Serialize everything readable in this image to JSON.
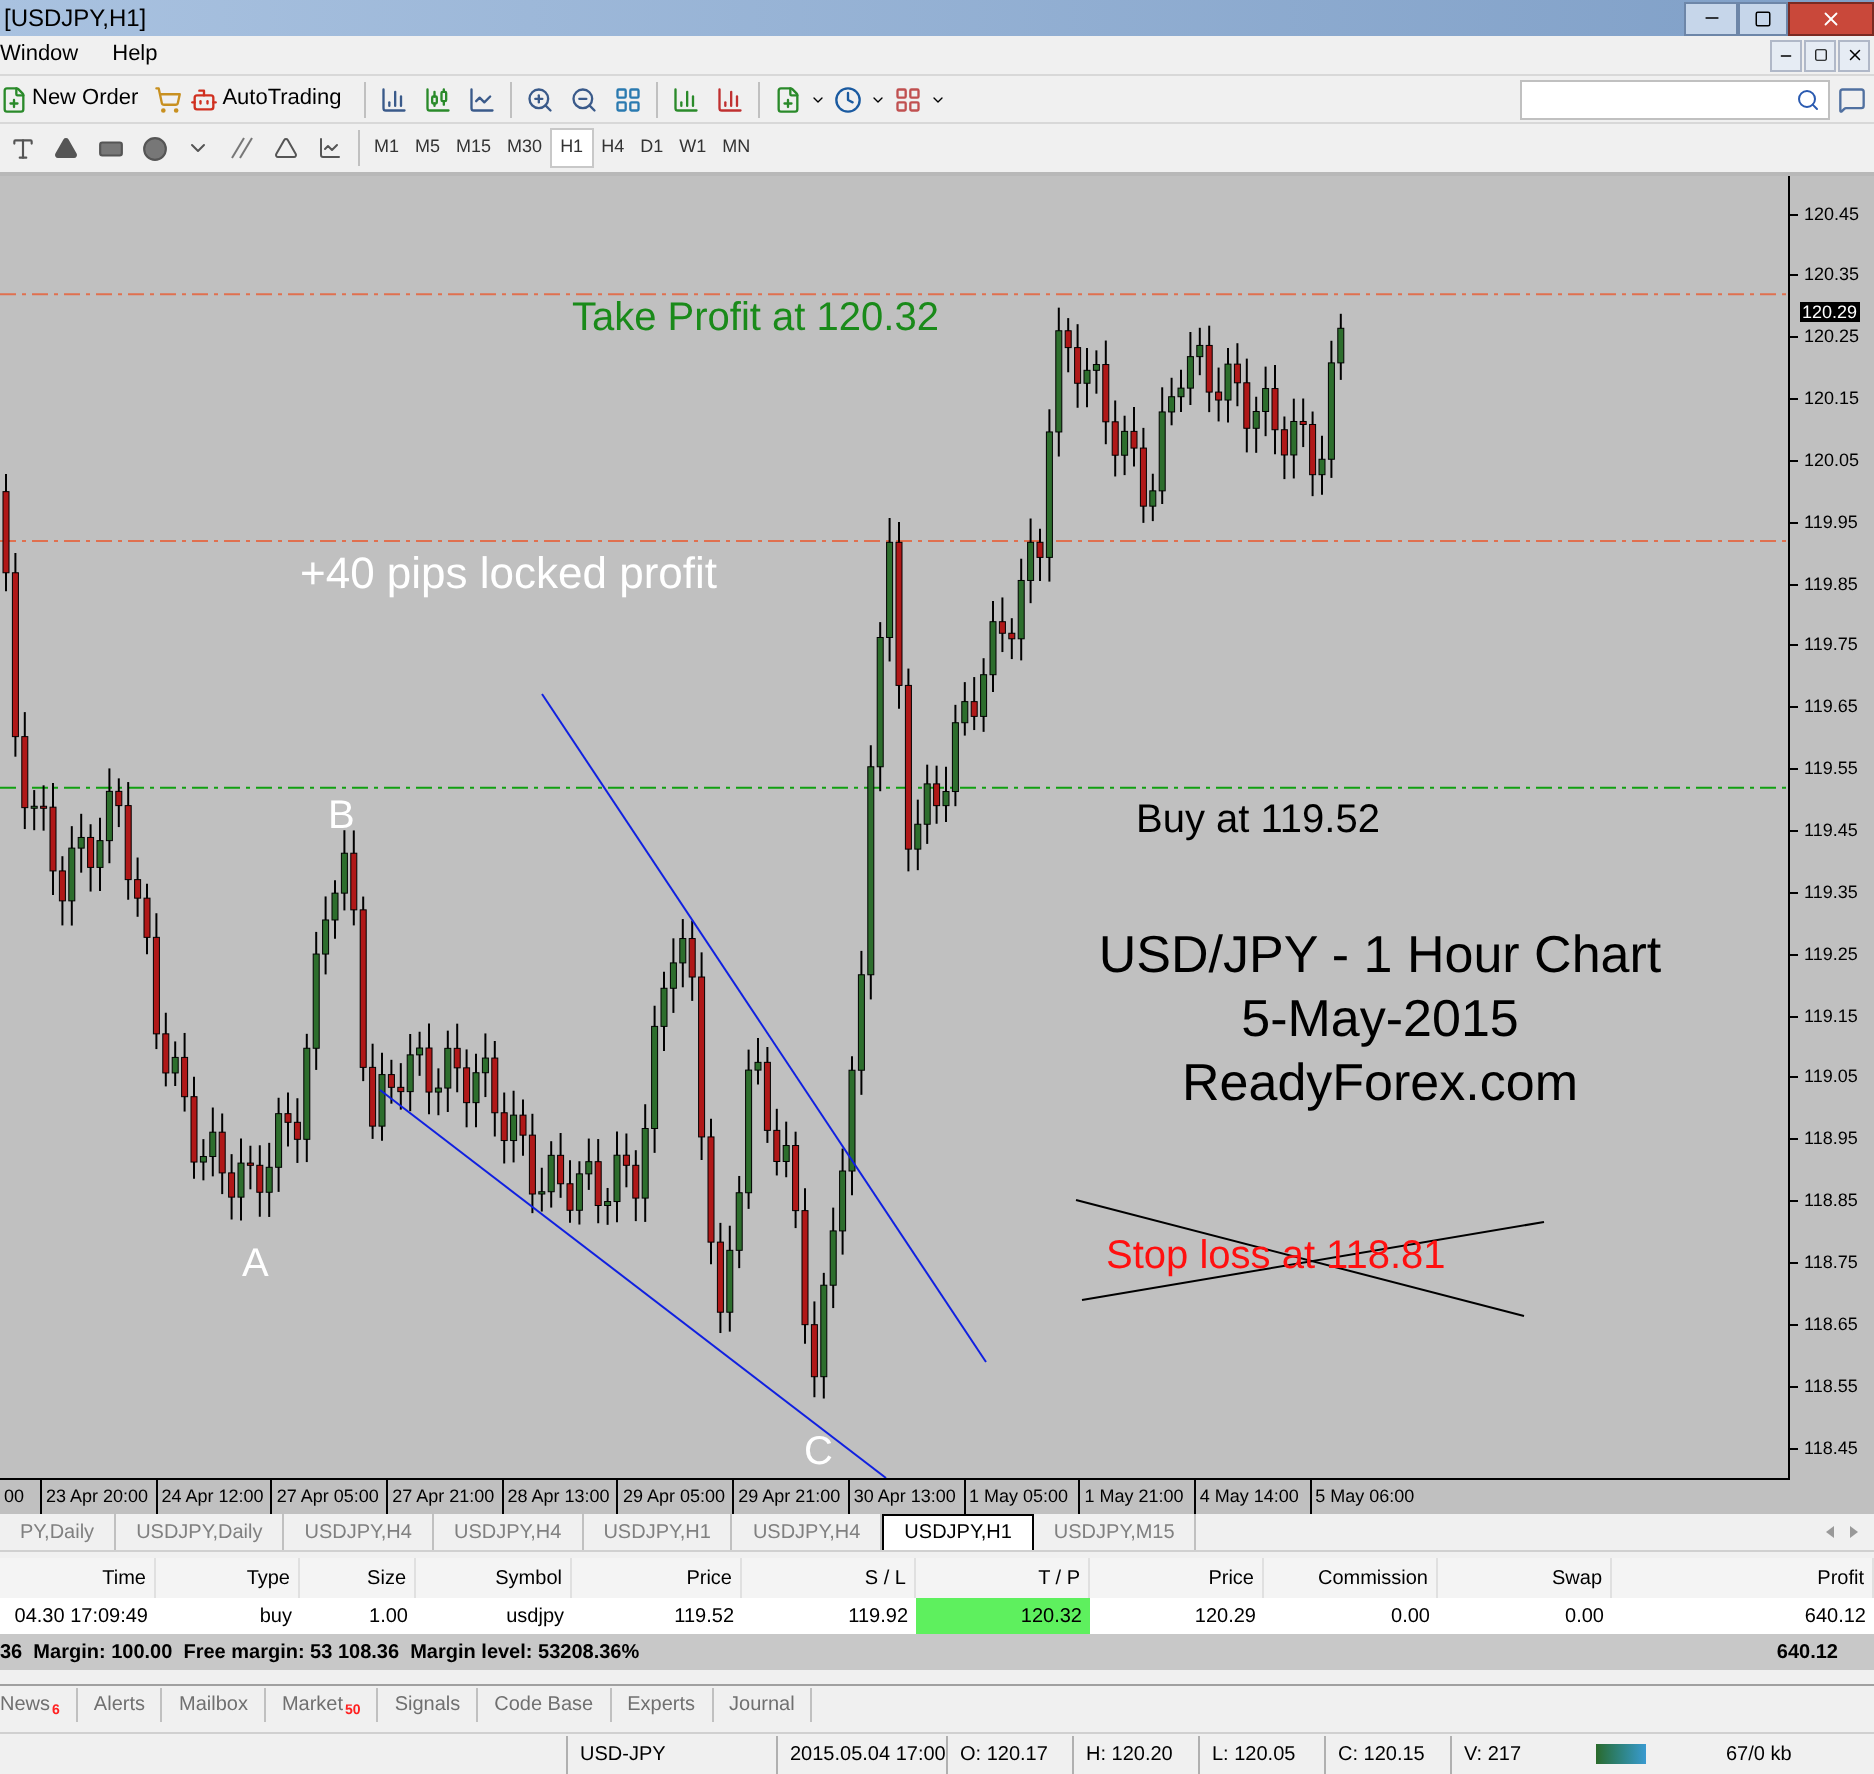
{
  "window": {
    "title": "[USDJPY,H1]"
  },
  "menu": [
    "Window",
    "Help"
  ],
  "toolbar": {
    "new_order": "New Order",
    "auto_trading": "AutoTrading"
  },
  "timeframes": [
    {
      "label": "M1",
      "selected": false
    },
    {
      "label": "M5",
      "selected": false
    },
    {
      "label": "M15",
      "selected": false
    },
    {
      "label": "M30",
      "selected": false
    },
    {
      "label": "H1",
      "selected": true
    },
    {
      "label": "H4",
      "selected": false
    },
    {
      "label": "D1",
      "selected": false
    },
    {
      "label": "W1",
      "selected": false
    },
    {
      "label": "MN",
      "selected": false
    }
  ],
  "chart": {
    "annotations": [
      {
        "kind": "take_profit",
        "text": "Take Profit at 120.32"
      },
      {
        "kind": "locked_profit",
        "text": "+40 pips locked profit"
      },
      {
        "kind": "point",
        "text": "B"
      },
      {
        "kind": "buy",
        "text": "Buy at 119.52"
      },
      {
        "kind": "title",
        "text": "USD/JPY - 1 Hour Chart"
      },
      {
        "kind": "title",
        "text": "5-May-2015"
      },
      {
        "kind": "title",
        "text": "ReadyForex.com"
      },
      {
        "kind": "point",
        "text": "A"
      },
      {
        "kind": "stop_loss",
        "text": "Stop loss at 118.81",
        "crossed": true
      },
      {
        "kind": "point",
        "text": "C"
      }
    ],
    "price_axis": [
      "120.45",
      "120.35",
      "120.25",
      "120.15",
      "120.05",
      "119.95",
      "119.85",
      "119.75",
      "119.65",
      "119.55",
      "119.45",
      "119.35",
      "119.25",
      "119.15",
      "119.05",
      "118.95",
      "118.85",
      "118.75",
      "118.65",
      "118.55",
      "118.45"
    ],
    "current_price": "120.29",
    "time_axis": [
      "00",
      "23 Apr 20:00",
      "24 Apr 12:00",
      "27 Apr 05:00",
      "27 Apr 21:00",
      "28 Apr 13:00",
      "29 Apr 05:00",
      "29 Apr 21:00",
      "30 Apr 13:00",
      "1 May 05:00",
      "1 May 21:00",
      "4 May 14:00",
      "5 May 06:00"
    ]
  },
  "chart_tabs": [
    {
      "label": "PY,Daily",
      "selected": false
    },
    {
      "label": "USDJPY,Daily",
      "selected": false
    },
    {
      "label": "USDJPY,H4",
      "selected": false
    },
    {
      "label": "USDJPY,H4",
      "selected": false
    },
    {
      "label": "USDJPY,H1",
      "selected": false
    },
    {
      "label": "USDJPY,H4",
      "selected": false
    },
    {
      "label": "USDJPY,H1",
      "selected": true
    },
    {
      "label": "USDJPY,M15",
      "selected": false
    }
  ],
  "trade_table": {
    "columns": [
      "Time",
      "Type",
      "Size",
      "Symbol",
      "Price",
      "S / L",
      "T / P",
      "Price",
      "Commission",
      "Swap",
      "Profit"
    ],
    "rows": [
      {
        "cells": [
          "04.30 17:09:49",
          "buy",
          "1.00",
          "usdjpy",
          "119.52",
          "119.92",
          "120.32",
          "120.29",
          "0.00",
          "0.00",
          "640.12"
        ],
        "tp_highlighted": true
      }
    ],
    "summary": "36  Margin: 100.00  Free margin: 53 108.36  Margin level: 53208.36%",
    "total": "640.12"
  },
  "terminal_tabs": [
    {
      "label": "News",
      "badge": "6"
    },
    {
      "label": "Alerts"
    },
    {
      "label": "Mailbox"
    },
    {
      "label": "Market",
      "badge": "50"
    },
    {
      "label": "Signals"
    },
    {
      "label": "Code Base"
    },
    {
      "label": "Experts"
    },
    {
      "label": "Journal"
    }
  ],
  "status_bar": [
    "USD-JPY",
    "2015.05.04 17:00",
    "O: 120.17",
    "H: 120.20",
    "L: 120.05",
    "C: 120.15",
    "V: 217",
    "67/0 kb"
  ]
}
